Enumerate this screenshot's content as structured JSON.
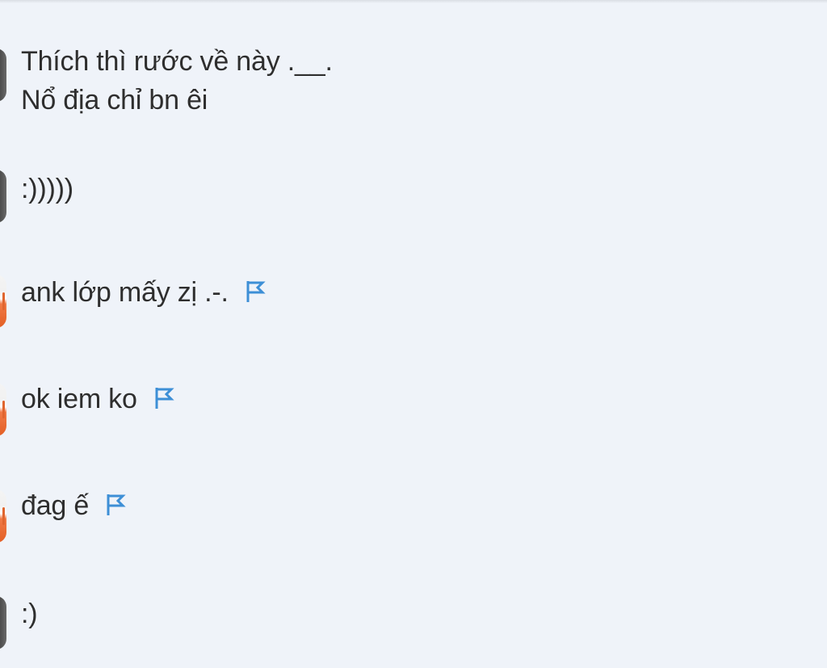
{
  "comments": [
    {
      "lines": [
        "Thích thì rước về này .__.",
        "Nổ địa chỉ bn êi"
      ],
      "has_flag": false,
      "avatar_color": "#555555"
    },
    {
      "lines": [
        ":)))))"
      ],
      "has_flag": false,
      "avatar_color": "#555555"
    },
    {
      "lines": [
        "ank lớp mấy zị .-."
      ],
      "has_flag": true,
      "avatar_color": "#e8622a"
    },
    {
      "lines": [
        "ok iem ko"
      ],
      "has_flag": true,
      "avatar_color": "#e8622a"
    },
    {
      "lines": [
        "đag ế"
      ],
      "has_flag": true,
      "avatar_color": "#e8622a"
    },
    {
      "lines": [
        ":)"
      ],
      "has_flag": false,
      "avatar_color": "#555555"
    }
  ],
  "flag_icon": "flag-icon",
  "flag_color": "#3d8fd6"
}
